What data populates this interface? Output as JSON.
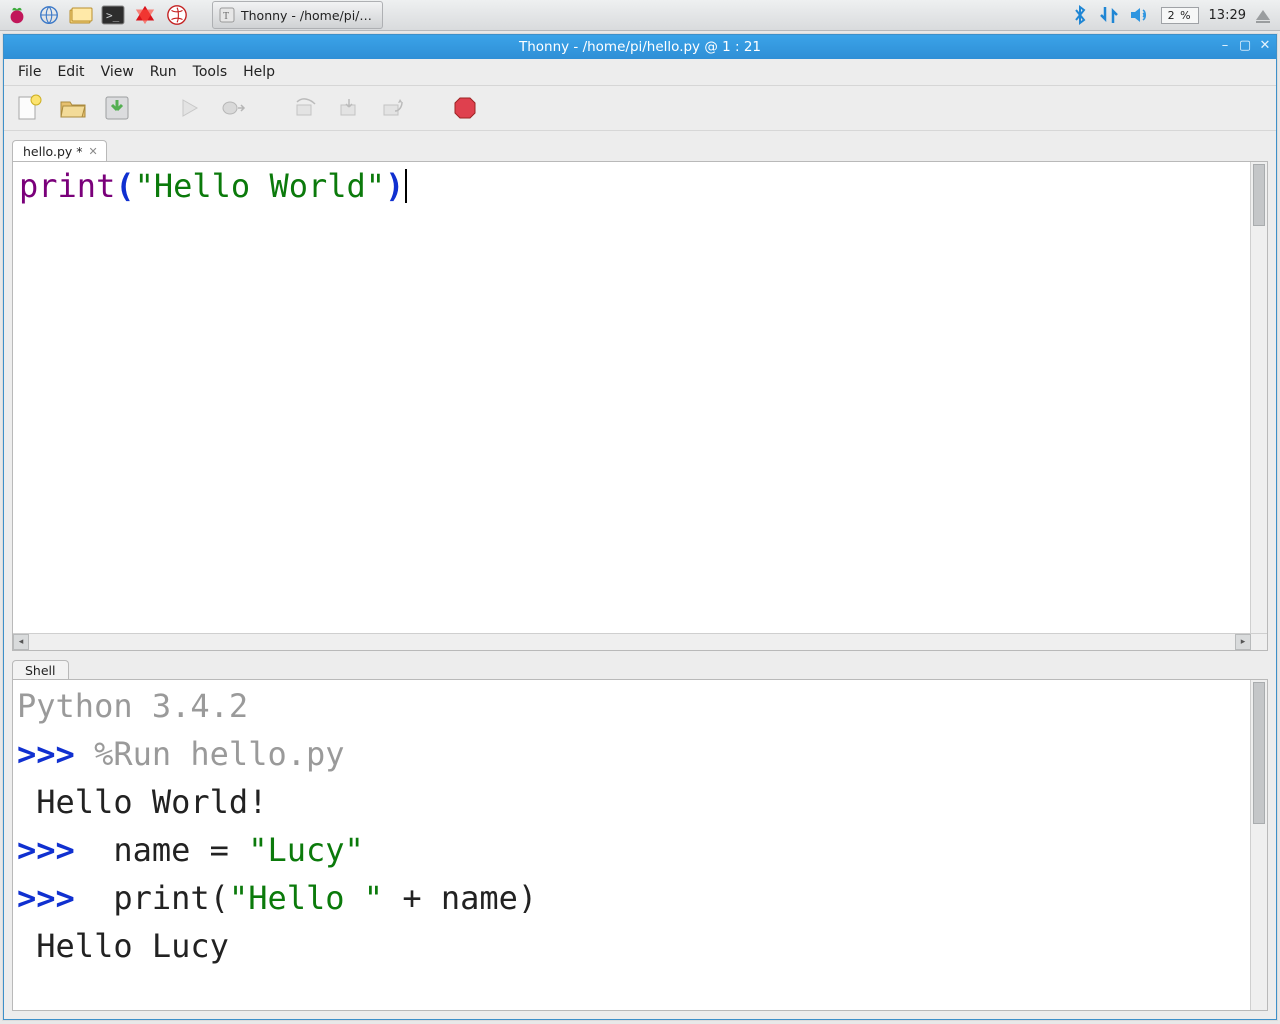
{
  "os_panel": {
    "taskbar_app_label": "Thonny  -  /home/pi/…",
    "cpu_percent": "2 %",
    "clock": "13:29"
  },
  "window": {
    "title": "Thonny  -  /home/pi/hello.py  @  1 : 21"
  },
  "menubar": [
    "File",
    "Edit",
    "View",
    "Run",
    "Tools",
    "Help"
  ],
  "toolbar_icons": [
    "new-file",
    "open-file",
    "save-file",
    "run",
    "debug",
    "step-over",
    "step-into",
    "step-out",
    "stop"
  ],
  "editor": {
    "tab_label": "hello.py *",
    "code": {
      "fn": "print",
      "open_paren": "(",
      "string": "\"Hello World\"",
      "close_paren": ")"
    }
  },
  "shell": {
    "tab_label": "Shell",
    "version_line": "Python 3.4.2",
    "lines": [
      {
        "prompt": ">>> ",
        "cmd": "%Run hello.py"
      },
      {
        "out": " Hello World!"
      },
      {
        "prompt": ">>> ",
        "code_plain_before": " name = ",
        "code_str": "\"Lucy\""
      },
      {
        "prompt": ">>> ",
        "code_plain_before": " print(",
        "code_str": "\"Hello \"",
        "code_plain_after": " + name)"
      },
      {
        "out": " Hello Lucy"
      }
    ]
  }
}
